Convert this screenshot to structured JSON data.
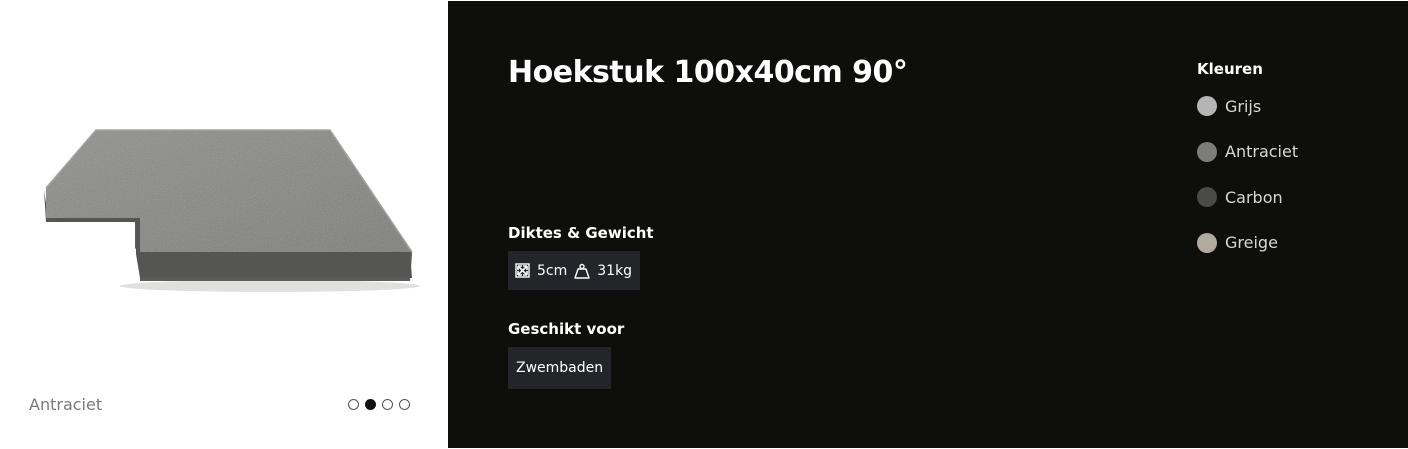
{
  "gallery": {
    "variant_label": "Antraciet",
    "slide_count": 4,
    "active_slide": 2
  },
  "product": {
    "title": "Hoekstuk 100x40cm 90°"
  },
  "specs": {
    "heading": "Diktes & Gewicht",
    "thickness": "5cm",
    "weight": "31kg",
    "thickness_icon": "expand-arrows-icon",
    "weight_icon": "weight-icon"
  },
  "suitable": {
    "heading": "Geschikt voor",
    "items": [
      "Zwembaden"
    ]
  },
  "colors": {
    "heading": "Kleuren",
    "items": [
      {
        "name": "Grijs",
        "swatch": "#b5b5b5"
      },
      {
        "name": "Antraciet",
        "swatch": "#7c7c7a"
      },
      {
        "name": "Carbon",
        "swatch": "#4a4a48"
      },
      {
        "name": "Greige",
        "swatch": "#b2aa9e"
      }
    ]
  },
  "theme": {
    "panel_bg": "#0e0e0c",
    "chip_bg": "#24252a"
  }
}
